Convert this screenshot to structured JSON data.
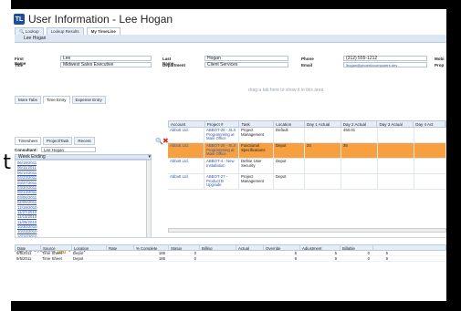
{
  "stray_char": "t",
  "app_title": "User Information - Lee Hogan",
  "logo_text": "TL",
  "top_tabs": [
    "Lookup",
    "Lookup Results",
    "My TimeLine"
  ],
  "breadcrumb": "Lee Hogan",
  "fields": {
    "first_name_label": "First Name",
    "first_name": "Lee",
    "title_label": "Title",
    "title": "Midwest Sales Executive",
    "last_name_label": "Last Name",
    "last_name": "Hogan",
    "department_label": "Department",
    "department": "Client Services",
    "phone_label": "Phone",
    "phone": "(312) 555-1212",
    "email_label": "Email",
    "email": "lhogan@phoenixcomputers.dev",
    "mobile_label": "Mobi",
    "prop_label": "Prop"
  },
  "more_tabs": [
    "More Tabs",
    "Time Entry",
    "Expense Entry"
  ],
  "drag_hint": "drag a tab here to show it in this area",
  "panel_tabs": [
    "Timesheet",
    "Project/Task",
    "Recent"
  ],
  "consultant_label": "Consultant:",
  "consultant_value": "Lee Hogan",
  "week_header": "Week Ending",
  "weeks": [
    "06/18/2011",
    "06/11/2011",
    "06/14/2011",
    "04/23/2011",
    "03/27/2011",
    "03/20/2011",
    "03/13/2011",
    "03/06/2011",
    "02/06/2011",
    "12/19/2010",
    "11/27/2010",
    "11/13/2010",
    "11/06/2010",
    "10/30/2010",
    "10/23/2010",
    "10/16/2010"
  ],
  "pager": {
    "text": "Page 1 of 4 (72 items)",
    "pages": [
      "[1]",
      "2",
      "3",
      "4"
    ]
  },
  "grid": {
    "headers": [
      "Account",
      "Project #",
      "Task",
      "Location",
      "Day 1 Actual",
      "Day 2 Actual",
      "Day 3 Actual",
      "Day 4 Act"
    ],
    "rows": [
      {
        "account": "Abbott Ltd.",
        "project": "ABBOT-28 - SLX Programming at Main Office",
        "task": "Project Management",
        "location": "Default",
        "d1": "",
        "d2": "450.01",
        "d3": "",
        "d4": "",
        "selected": false
      },
      {
        "account": "Abbott Ltd.",
        "project": "ABBOT-28 - SLX Programming at Main Office",
        "task": "Functional Specifications",
        "location": "Depot",
        "d1": "24",
        "d2": "36",
        "d3": "",
        "d4": "",
        "selected": true
      },
      {
        "account": "Abbott Ltd.",
        "project": "ABBOT-4 - New Installation",
        "task": "Define User Security",
        "location": "Depot",
        "d1": "",
        "d2": "",
        "d3": "",
        "d4": "",
        "selected": false
      },
      {
        "account": "Abbott Ltd.",
        "project": "ABBOT-27 - Product B Upgrade",
        "task": "Project Management",
        "location": "Depot",
        "d1": "",
        "d2": "",
        "d3": "",
        "d4": "",
        "selected": false
      }
    ]
  },
  "bottom": {
    "headers": [
      "Date",
      "Source",
      "Location",
      "Rate",
      "% Complete",
      "Status",
      "Billing",
      "Actual",
      "Override",
      "Adjustment",
      "Billable"
    ],
    "rows": [
      [
        "9/5/2011",
        "Time Sheet",
        "Depot",
        "",
        "185",
        "0",
        "",
        "",
        "5",
        "5",
        "0",
        "5"
      ],
      [
        "9/5/2011",
        "Time Sheet",
        "Depot",
        "",
        "185",
        "0",
        "",
        "",
        "9",
        "9",
        "0",
        "9"
      ]
    ]
  }
}
